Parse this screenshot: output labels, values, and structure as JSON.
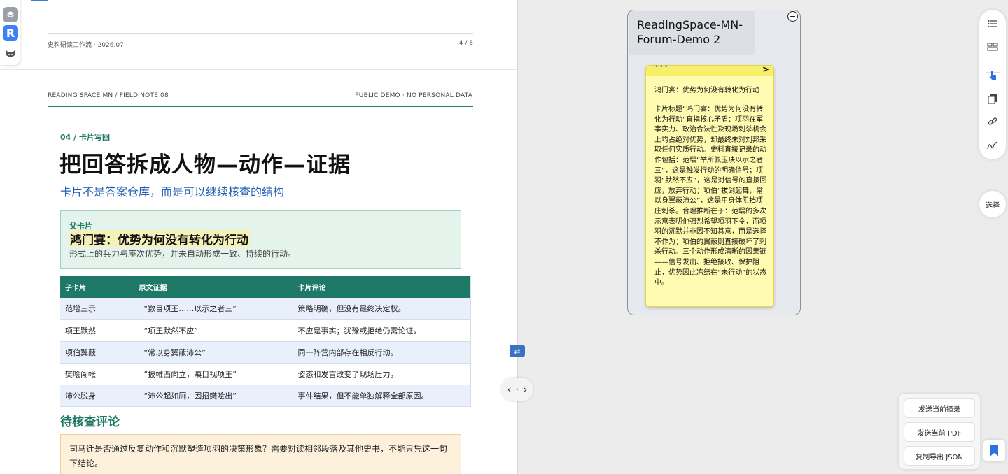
{
  "pdf": {
    "prev_footer_left": "史料研读工作流 · 2026.07",
    "prev_footer_right": "4 / 8",
    "header_left": "READING SPACE MN / FIELD NOTE 08",
    "header_right": "PUBLIC DEMO · NO PERSONAL DATA",
    "section_kicker": "04 / 卡片写回",
    "title": "把回答拆成人物—动作—证据",
    "subtitle": "卡片不是答案仓库，而是可以继续核查的结构",
    "parent_card": {
      "label": "父卡片",
      "title": "鸿门宴：优势为何没有转化为行动",
      "description": "形式上的兵力与座次优势，并未自动形成一致、持续的行动。"
    },
    "table": {
      "headers": [
        "子卡片",
        "原文证据",
        "卡片评论"
      ],
      "rows": [
        [
          "范增三示",
          "“数目项王……以示之者三”",
          "策略明确，但没有最终决定权。"
        ],
        [
          "项王默然",
          "“项王默然不应”",
          "不应是事实；犹豫或拒绝仍需论证。"
        ],
        [
          "项伯翼蔽",
          "“常以身翼蔽沛公”",
          "同一阵营内部存在相反行动。"
        ],
        [
          "樊哙闯帐",
          "“披帷西向立，瞋目视项王”",
          "姿态和发言改变了现场压力。"
        ],
        [
          "沛公脱身",
          "“沛公起如厕，因招樊哙出”",
          "事件结果，但不能单独解释全部原因。"
        ]
      ]
    },
    "review_heading": "待核查评论",
    "review_text": "司马迁是否通过反复动作和沉默塑造项羽的决策形象？需要对读相邻段落及其他史书，不能只凭这一句下结论。"
  },
  "canvas": {
    "group_title": "ReadingSpace-MN-Forum-Demo 2",
    "note": {
      "dots": "•••",
      "chevron": ">",
      "title": "鸿门宴：优势为何没有转化为行动",
      "body": "卡片标题“鸿门宴：优势为何没有转化为行动”直指核心矛盾：项羽在军事实力、政治合法性及现场刺杀机会上均占绝对优势，却最终未对刘邦采取任何实质行动。史料直接记录的动作包括：范增“举所佩玉玦以示之者三”，这是触发行动的明确信号；项羽“默然不应”，这是对信号的直接回应，放弃行动；项伯“拔剑起舞，常以身翼蔽沛公”，这是用身体阻挡项庄刺杀。合理推断在于：范增的多次示意表明他强烈希望项羽下令，而项羽的沉默并非因不知其意，而是选择不作为；项伯的翼蔽则直接破坏了刺杀行动。三个动作形成清晰的因果链——信号发出、拒绝接收、保护阻止，优势因此冻结在“未行动”的状态中。"
    }
  },
  "toolbar": {
    "select_label": "选择",
    "icons": [
      "list-icon",
      "layout-icon",
      "pointer-icon",
      "copy-icon",
      "link-icon",
      "draw-icon"
    ]
  },
  "export": {
    "send_summary": "发送当前摘录",
    "send_pdf": "发送当前 PDF",
    "copy_json": "复制导出 JSON"
  },
  "mini_toolbar": {
    "app_letter": "R"
  },
  "colors": {
    "accent_green": "#1e7a66",
    "accent_blue": "#2f6fe0",
    "note_yellow": "#fffbb0"
  }
}
